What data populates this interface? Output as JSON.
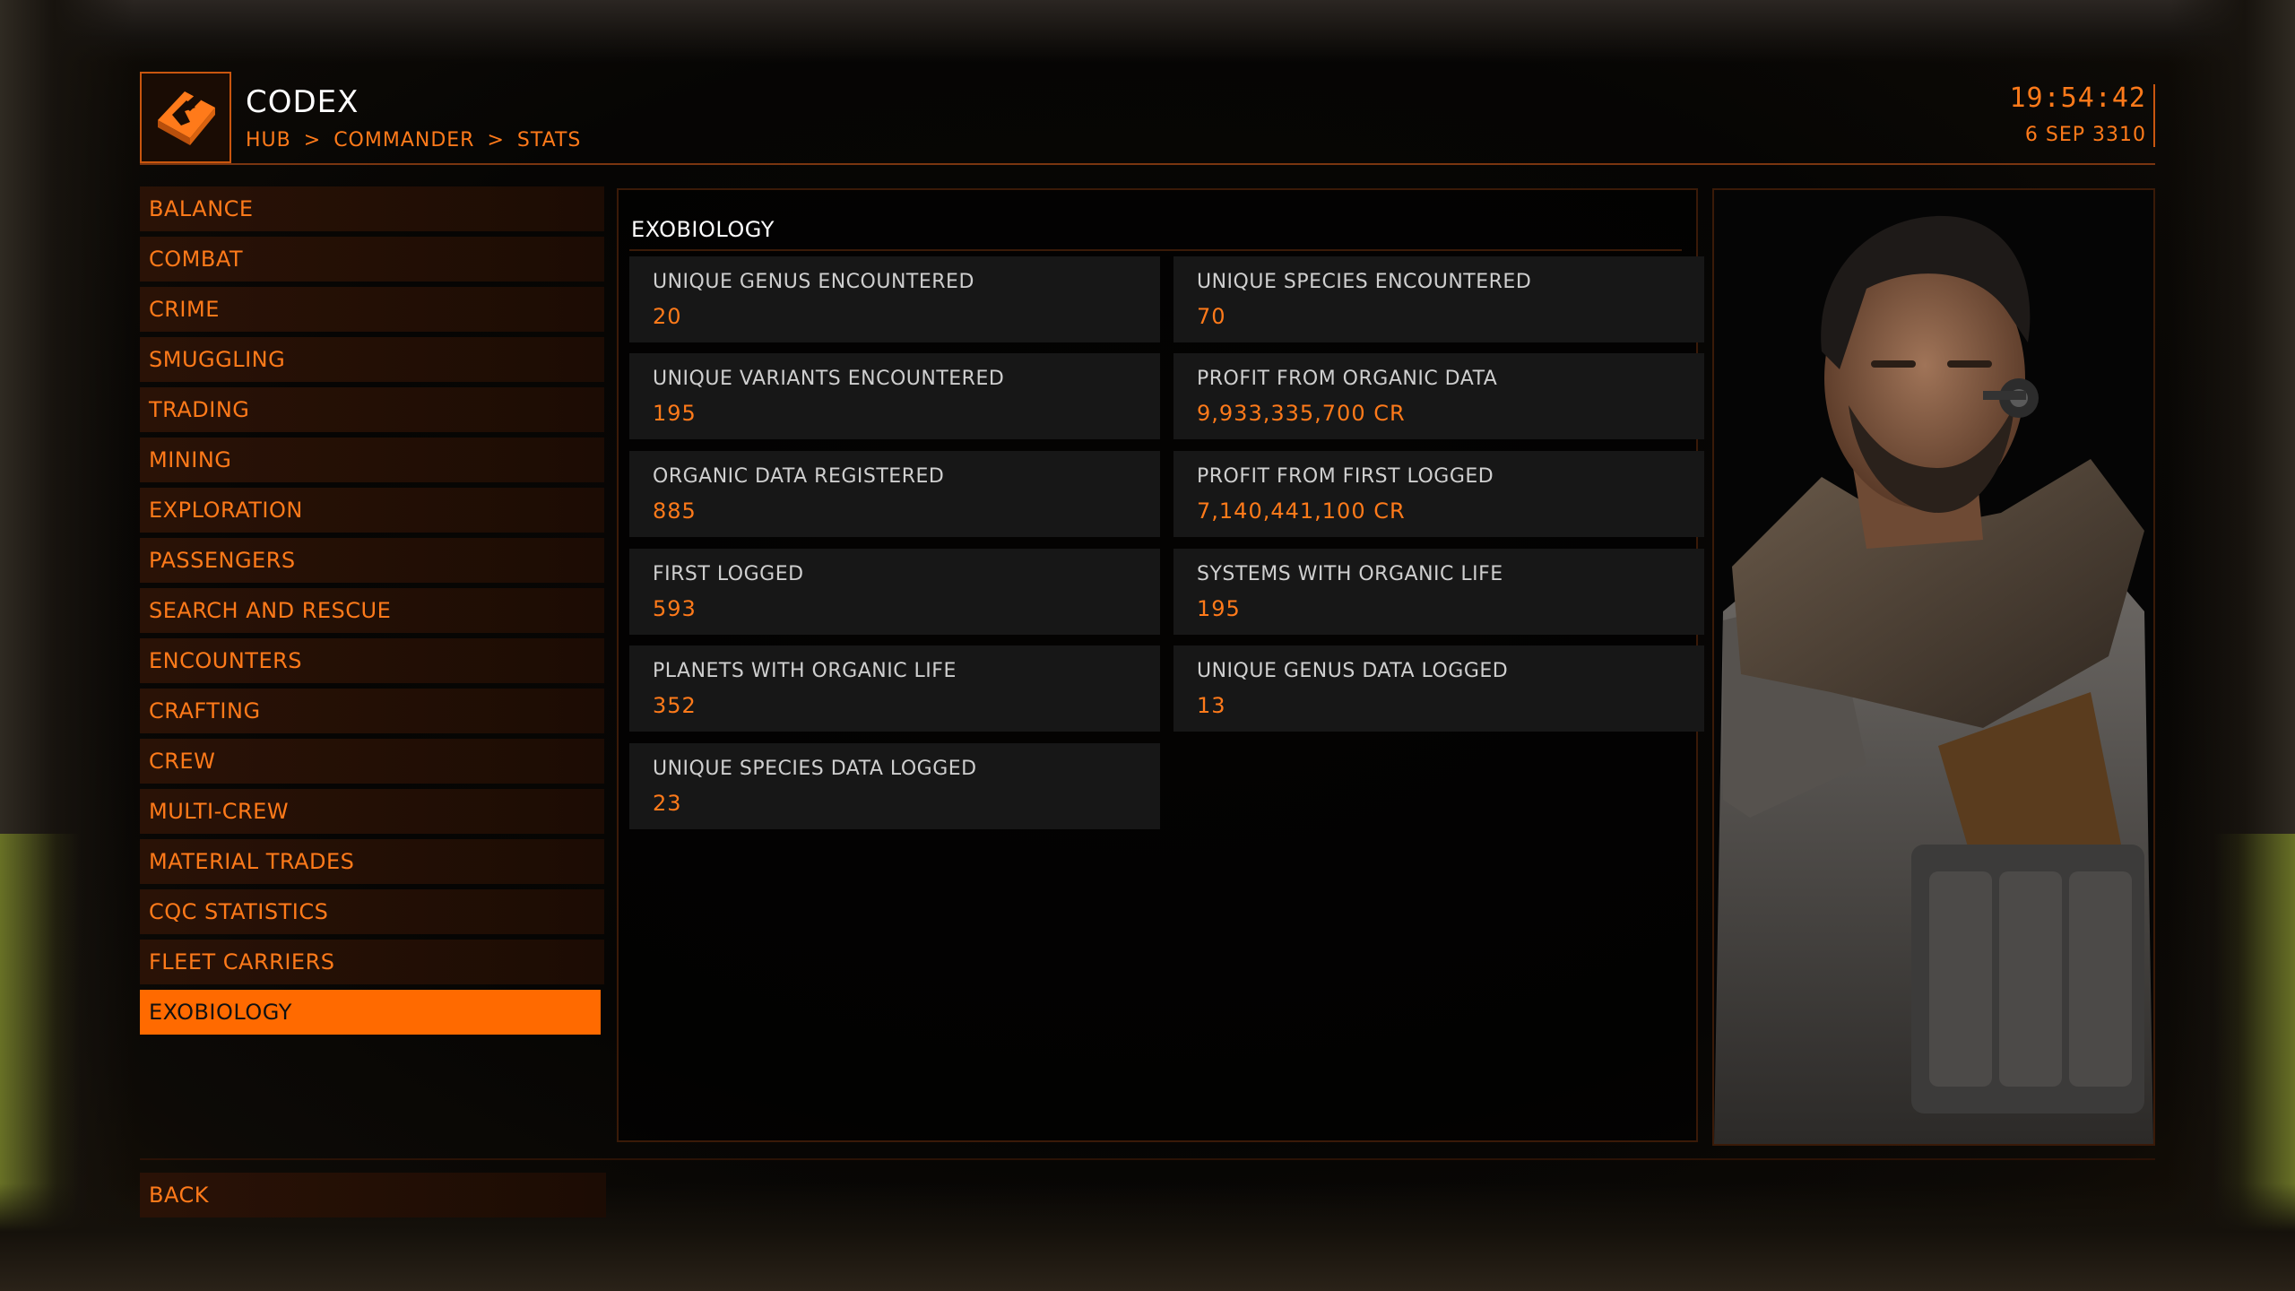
{
  "header": {
    "title": "CODEX",
    "breadcrumb": [
      "HUB",
      ">",
      "COMMANDER",
      ">",
      "STATS"
    ],
    "time": "19:54:42",
    "date": "6 SEP 3310"
  },
  "sidebar": {
    "items": [
      {
        "label": "BALANCE"
      },
      {
        "label": "COMBAT"
      },
      {
        "label": "CRIME"
      },
      {
        "label": "SMUGGLING"
      },
      {
        "label": "TRADING"
      },
      {
        "label": "MINING"
      },
      {
        "label": "EXPLORATION"
      },
      {
        "label": "PASSENGERS"
      },
      {
        "label": "SEARCH AND RESCUE"
      },
      {
        "label": "ENCOUNTERS"
      },
      {
        "label": "CRAFTING"
      },
      {
        "label": "CREW"
      },
      {
        "label": "MULTI-CREW"
      },
      {
        "label": "MATERIAL TRADES"
      },
      {
        "label": "CQC STATISTICS"
      },
      {
        "label": "FLEET CARRIERS"
      },
      {
        "label": "EXOBIOLOGY"
      }
    ],
    "selected": "EXOBIOLOGY"
  },
  "main": {
    "section_title": "EXOBIOLOGY",
    "stats": [
      {
        "label": "UNIQUE GENUS ENCOUNTERED",
        "value": "20"
      },
      {
        "label": "UNIQUE SPECIES ENCOUNTERED",
        "value": "70"
      },
      {
        "label": "UNIQUE VARIANTS ENCOUNTERED",
        "value": "195"
      },
      {
        "label": "PROFIT FROM ORGANIC DATA",
        "value": "9,933,335,700 CR"
      },
      {
        "label": "ORGANIC DATA REGISTERED",
        "value": "885"
      },
      {
        "label": "PROFIT FROM FIRST LOGGED",
        "value": "7,140,441,100 CR"
      },
      {
        "label": "FIRST LOGGED",
        "value": "593"
      },
      {
        "label": "SYSTEMS WITH ORGANIC LIFE",
        "value": "195"
      },
      {
        "label": "PLANETS WITH ORGANIC LIFE",
        "value": "352"
      },
      {
        "label": "UNIQUE GENUS DATA LOGGED",
        "value": "13"
      },
      {
        "label": "UNIQUE SPECIES DATA LOGGED",
        "value": "23"
      }
    ]
  },
  "footer": {
    "back_label": "BACK"
  },
  "colors": {
    "accent": "#ff7a1a",
    "accent_strong": "#ff6a00",
    "tile_bg": "#171717",
    "label_text": "#cfcfcf",
    "title_text": "#ffffff"
  },
  "icons": {
    "codex": "codex-book-icon",
    "portrait": "commander-portrait"
  }
}
